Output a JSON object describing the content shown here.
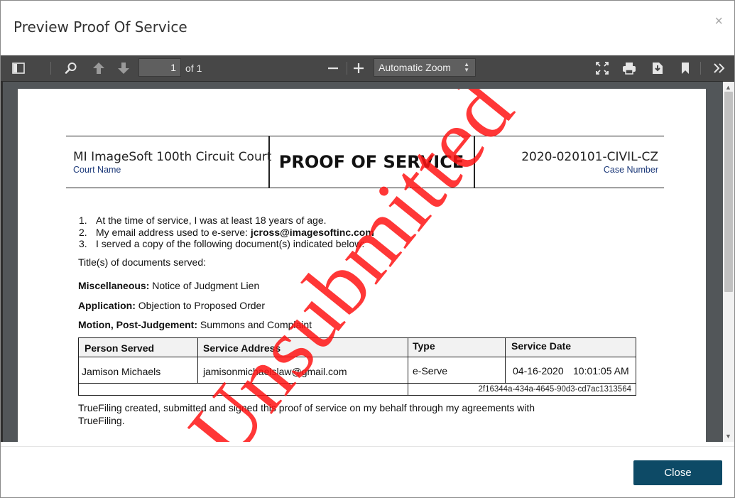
{
  "dialog": {
    "title": "Preview Proof Of Service",
    "close_glyph": "×"
  },
  "toolbar": {
    "current_page": "1",
    "page_of": "of 1",
    "zoom_value": "Automatic Zoom",
    "icons": [
      "sidebar-toggle-icon",
      "search-icon",
      "previous-page-icon",
      "next-page-icon",
      "zoom-out-icon",
      "zoom-in-icon",
      "presentation-mode-icon",
      "print-icon",
      "download-icon",
      "bookmark-icon",
      "tools-chevron-icon"
    ]
  },
  "document": {
    "court_name": "MI ImageSoft 100th Circuit Court",
    "court_name_label": "Court Name",
    "title": "PROOF OF SERVICE",
    "case_number": "2020-020101-CIVIL-CZ",
    "case_number_label": "Case Number",
    "items": [
      {
        "num": "1.",
        "text": "At the time of service, I was at least 18 years of age."
      },
      {
        "num": "2.",
        "text": "My email address used to e-serve: ",
        "bold": "jcross@imagesoftinc.com"
      },
      {
        "num": "3.",
        "text": "I served a copy of the following document(s) indicated below:"
      }
    ],
    "titles_label": "Title(s) of documents served:",
    "documents": [
      {
        "label": "Miscellaneous:",
        "value": " Notice of Judgment Lien"
      },
      {
        "label": "Application:",
        "value": " Objection to Proposed Order"
      },
      {
        "label": "Motion, Post-Judgement:",
        "value": " Summons and Complaint"
      }
    ],
    "table": {
      "headers": [
        "Person Served",
        "Service Address",
        "Type",
        "Service Date"
      ],
      "row": {
        "person": "Jamison Michaels",
        "address": "jamisonmichaelslaw@gmail.com",
        "type": "e-Serve",
        "date": "04-16-2020",
        "time": "10:01:05 AM"
      },
      "hash": "2f16344a-434a-4645-90d3-cd7ac1313564"
    },
    "footer": "TrueFiling created, submitted and signed this proof of service on my behalf through my agreements with TrueFiling.",
    "watermark": "Unsubmitted",
    "watermark_color": "#ff1414"
  },
  "buttons": {
    "close": "Close"
  },
  "colors": {
    "toolbar_bg": "#474747",
    "viewer_bg": "#525659",
    "primary_button": "#0d4a66",
    "label_blue": "#1d3a7a"
  }
}
